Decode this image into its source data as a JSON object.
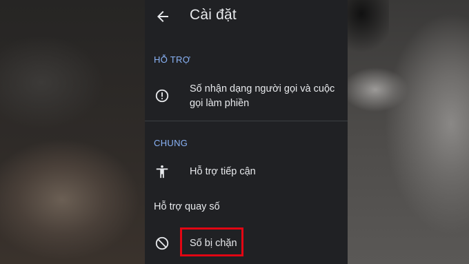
{
  "settings": {
    "title": "Cài đặt",
    "sections": [
      {
        "header": "HỖ TRỢ",
        "items": [
          {
            "icon": "info-circle-icon",
            "label": "Số nhận dạng người gọi và cuộc gọi làm phiền"
          }
        ]
      },
      {
        "header": "CHUNG",
        "items": [
          {
            "icon": "accessibility-icon",
            "label": "Hỗ trợ tiếp cận"
          },
          {
            "icon": "",
            "label": "Hỗ trợ quay số"
          },
          {
            "icon": "block-icon",
            "label": "Số bị chặn",
            "highlighted": true
          }
        ]
      }
    ]
  },
  "colors": {
    "panel_bg": "#202124",
    "text": "#e8eaed",
    "section_header": "#8ab4f8",
    "highlight_border": "#e30613"
  }
}
